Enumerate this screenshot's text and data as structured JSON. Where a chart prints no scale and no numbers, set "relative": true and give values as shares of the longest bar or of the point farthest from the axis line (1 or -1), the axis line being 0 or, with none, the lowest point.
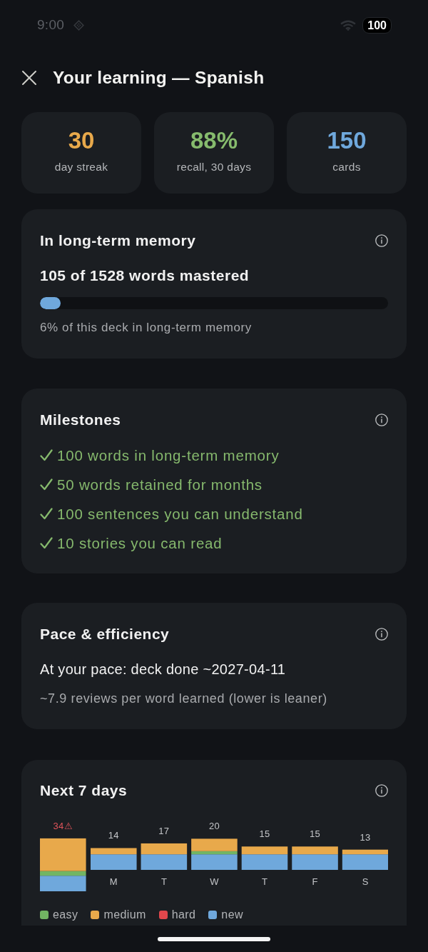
{
  "status_bar": {
    "time": "9:00",
    "battery": "100"
  },
  "header": {
    "title": "Your learning — Spanish"
  },
  "stats": [
    {
      "value": "30",
      "label": "day streak",
      "color": "#e8a94b"
    },
    {
      "value": "88%",
      "label": "recall, 30 days",
      "color": "#86bb6d"
    },
    {
      "value": "150",
      "label": "cards",
      "color": "#6fa8dc"
    }
  ],
  "memory": {
    "title": "In long-term memory",
    "headline": "105 of 1528 words mastered",
    "level": 0.06,
    "caption": "6% of this deck in long-term memory"
  },
  "milestones": {
    "title": "Milestones",
    "items": [
      {
        "text": "100 words in long-term memory",
        "checked": true
      },
      {
        "text": "50 words retained for months",
        "checked": true
      },
      {
        "text": "100 sentences you can understand",
        "checked": true
      },
      {
        "text": "10 stories you can read",
        "checked": true
      }
    ]
  },
  "pace": {
    "title": "Pace & efficiency",
    "estimate": "At your pace: deck done ~2027-04-11",
    "efficiency": "~7.9 reviews per word learned (lower is leaner)"
  },
  "forecast": {
    "title": "Next 7 days",
    "first_bar": {
      "warning": true,
      "chart_data": {
        "type": "bar",
        "stacked": true,
        "relative": true,
        "series": [
          {
            "color": "#6fa8dc",
            "values": [
              0.294
            ]
          },
          {
            "color": "#72b563",
            "values": [
              0.088
            ]
          },
          {
            "color": "#e8a94b",
            "values": [
              0.618
            ]
          }
        ],
        "value_labels": [
          "34⚠"
        ]
      }
    },
    "days": {
      "warning": false,
      "chart_data": {
        "type": "bar",
        "stacked": true,
        "relative": true,
        "categories": [
          "M",
          "T",
          "W",
          "T",
          "F",
          "S"
        ],
        "series": [
          {
            "color": "#6fa8dc",
            "values": [
              0.5,
              0.5,
              0.5,
              0.5,
              0.5,
              0.5
            ]
          },
          {
            "color": "#72b563",
            "values": [
              0,
              0,
              0.1,
              0,
              0,
              0
            ]
          },
          {
            "color": "#e8a94b",
            "values": [
              0.2,
              0.35,
              0.4,
              0.25,
              0.25,
              0.15
            ]
          }
        ],
        "value_labels": [
          "14",
          "17",
          "20",
          "15",
          "15",
          "13"
        ]
      }
    },
    "legend": [
      {
        "label": "easy",
        "color": "#72b563"
      },
      {
        "label": "medium",
        "color": "#e8a94b"
      },
      {
        "label": "hard",
        "color": "#e0474c"
      },
      {
        "label": "new",
        "color": "#6fa8dc"
      }
    ]
  }
}
